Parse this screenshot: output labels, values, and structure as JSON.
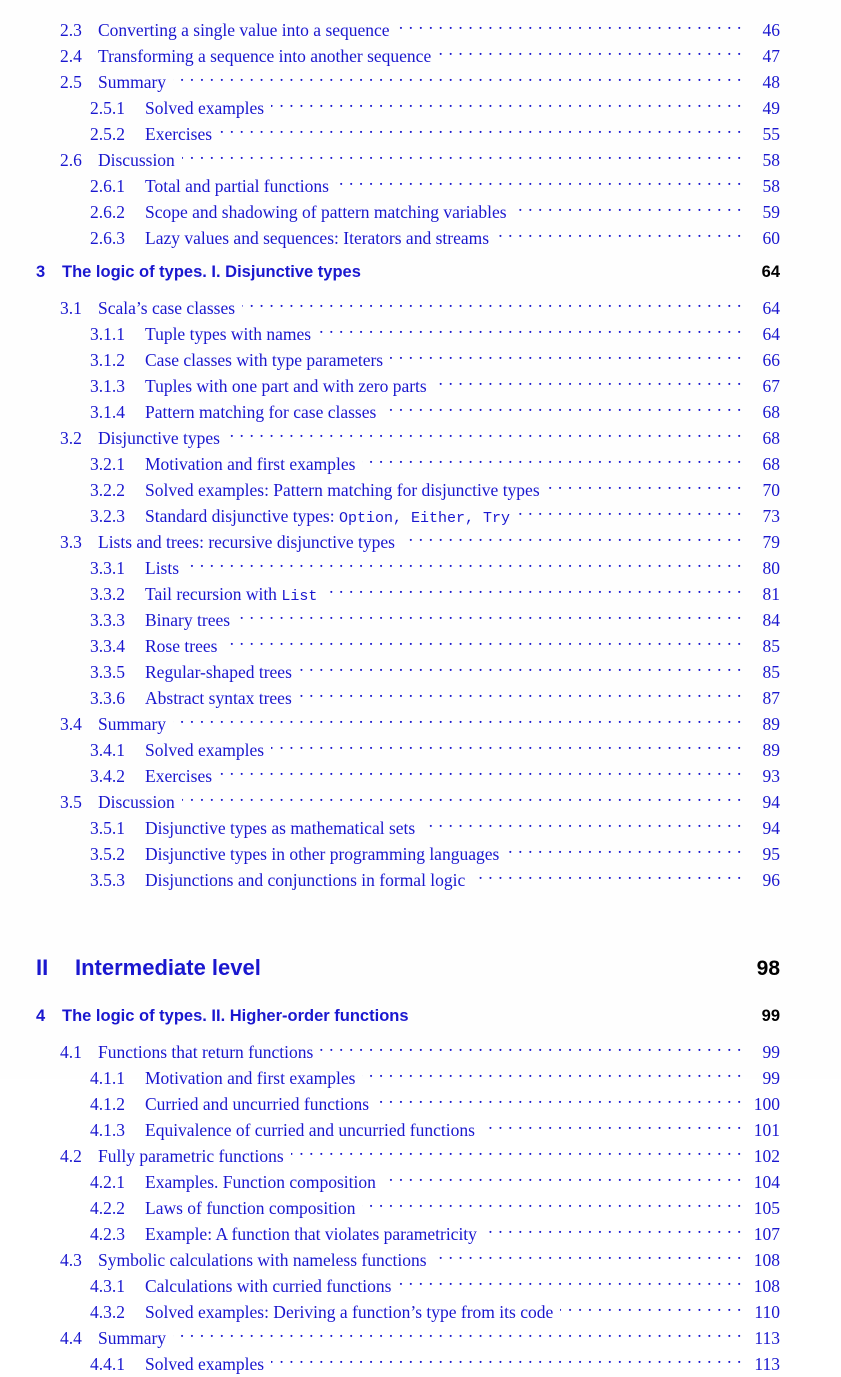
{
  "document": {
    "kind": "table-of-contents",
    "text_color": "#1a17cf",
    "heading_page_color": "#000000",
    "background": "#fefefe"
  },
  "entries": [
    {
      "type": "section",
      "number": "2.3",
      "title": "Converting a single value into a sequence",
      "page": "46"
    },
    {
      "type": "section",
      "number": "2.4",
      "title": "Transforming a sequence into another sequence",
      "page": "47"
    },
    {
      "type": "section",
      "number": "2.5",
      "title": "Summary",
      "page": "48"
    },
    {
      "type": "subsection",
      "number": "2.5.1",
      "title": "Solved examples",
      "page": "49"
    },
    {
      "type": "subsection",
      "number": "2.5.2",
      "title": "Exercises",
      "page": "55"
    },
    {
      "type": "section",
      "number": "2.6",
      "title": "Discussion",
      "page": "58"
    },
    {
      "type": "subsection",
      "number": "2.6.1",
      "title": "Total and partial functions",
      "page": "58"
    },
    {
      "type": "subsection",
      "number": "2.6.2",
      "title": "Scope and shadowing of pattern matching variables",
      "page": "59"
    },
    {
      "type": "subsection",
      "number": "2.6.3",
      "title": "Lazy values and sequences: Iterators and streams",
      "page": "60"
    },
    {
      "type": "chapter",
      "number": "3",
      "title": "The logic of types. I. Disjunctive types",
      "page": "64"
    },
    {
      "type": "section",
      "number": "3.1",
      "title": "Scala’s case classes",
      "page": "64"
    },
    {
      "type": "subsection",
      "number": "3.1.1",
      "title": "Tuple types with names",
      "page": "64"
    },
    {
      "type": "subsection",
      "number": "3.1.2",
      "title": "Case classes with type parameters",
      "page": "66"
    },
    {
      "type": "subsection",
      "number": "3.1.3",
      "title": "Tuples with one part and with zero parts",
      "page": "67"
    },
    {
      "type": "subsection",
      "number": "3.1.4",
      "title": "Pattern matching for case classes",
      "page": "68"
    },
    {
      "type": "section",
      "number": "3.2",
      "title": "Disjunctive types",
      "page": "68"
    },
    {
      "type": "subsection",
      "number": "3.2.1",
      "title": "Motivation and first examples",
      "page": "68"
    },
    {
      "type": "subsection",
      "number": "3.2.2",
      "title": "Solved examples: Pattern matching for disjunctive types",
      "page": "70"
    },
    {
      "type": "subsection",
      "number": "3.2.3",
      "title": "Standard disjunctive types: ",
      "title_code": "Option, Either, Try",
      "page": "73"
    },
    {
      "type": "section",
      "number": "3.3",
      "title": "Lists and trees: recursive disjunctive types",
      "page": "79"
    },
    {
      "type": "subsection",
      "number": "3.3.1",
      "title": "Lists",
      "page": "80"
    },
    {
      "type": "subsection",
      "number": "3.3.2",
      "title": "Tail recursion with ",
      "title_code": "List",
      "page": "81"
    },
    {
      "type": "subsection",
      "number": "3.3.3",
      "title": "Binary trees",
      "page": "84"
    },
    {
      "type": "subsection",
      "number": "3.3.4",
      "title": "Rose trees",
      "page": "85"
    },
    {
      "type": "subsection",
      "number": "3.3.5",
      "title": "Regular-shaped trees",
      "page": "85"
    },
    {
      "type": "subsection",
      "number": "3.3.6",
      "title": "Abstract syntax trees",
      "page": "87"
    },
    {
      "type": "section",
      "number": "3.4",
      "title": "Summary",
      "page": "89"
    },
    {
      "type": "subsection",
      "number": "3.4.1",
      "title": "Solved examples",
      "page": "89"
    },
    {
      "type": "subsection",
      "number": "3.4.2",
      "title": "Exercises",
      "page": "93"
    },
    {
      "type": "section",
      "number": "3.5",
      "title": "Discussion",
      "page": "94"
    },
    {
      "type": "subsection",
      "number": "3.5.1",
      "title": "Disjunctive types as mathematical sets",
      "page": "94"
    },
    {
      "type": "subsection",
      "number": "3.5.2",
      "title": "Disjunctive types in other programming languages",
      "page": "95"
    },
    {
      "type": "subsection",
      "number": "3.5.3",
      "title": "Disjunctions and conjunctions in formal logic",
      "page": "96"
    },
    {
      "type": "part",
      "number": "II",
      "title": "Intermediate level",
      "page": "98"
    },
    {
      "type": "chapter",
      "number": "4",
      "title": "The logic of types. II. Higher-order functions",
      "page": "99"
    },
    {
      "type": "section",
      "number": "4.1",
      "title": "Functions that return functions",
      "page": "99"
    },
    {
      "type": "subsection",
      "number": "4.1.1",
      "title": "Motivation and first examples",
      "page": "99"
    },
    {
      "type": "subsection",
      "number": "4.1.2",
      "title": "Curried and uncurried functions",
      "page": "100"
    },
    {
      "type": "subsection",
      "number": "4.1.3",
      "title": "Equivalence of curried and uncurried functions",
      "page": "101"
    },
    {
      "type": "section",
      "number": "4.2",
      "title": "Fully parametric functions",
      "page": "102"
    },
    {
      "type": "subsection",
      "number": "4.2.1",
      "title": "Examples. Function composition",
      "page": "104"
    },
    {
      "type": "subsection",
      "number": "4.2.2",
      "title": "Laws of function composition",
      "page": "105"
    },
    {
      "type": "subsection",
      "number": "4.2.3",
      "title": "Example: A function that violates parametricity",
      "page": "107"
    },
    {
      "type": "section",
      "number": "4.3",
      "title": "Symbolic calculations with nameless functions",
      "page": "108"
    },
    {
      "type": "subsection",
      "number": "4.3.1",
      "title": "Calculations with curried functions",
      "page": "108"
    },
    {
      "type": "subsection",
      "number": "4.3.2",
      "title": "Solved examples: Deriving a function’s type from its code",
      "page": "110"
    },
    {
      "type": "section",
      "number": "4.4",
      "title": "Summary",
      "page": "113"
    },
    {
      "type": "subsection",
      "number": "4.4.1",
      "title": "Solved examples",
      "page": "113"
    }
  ]
}
